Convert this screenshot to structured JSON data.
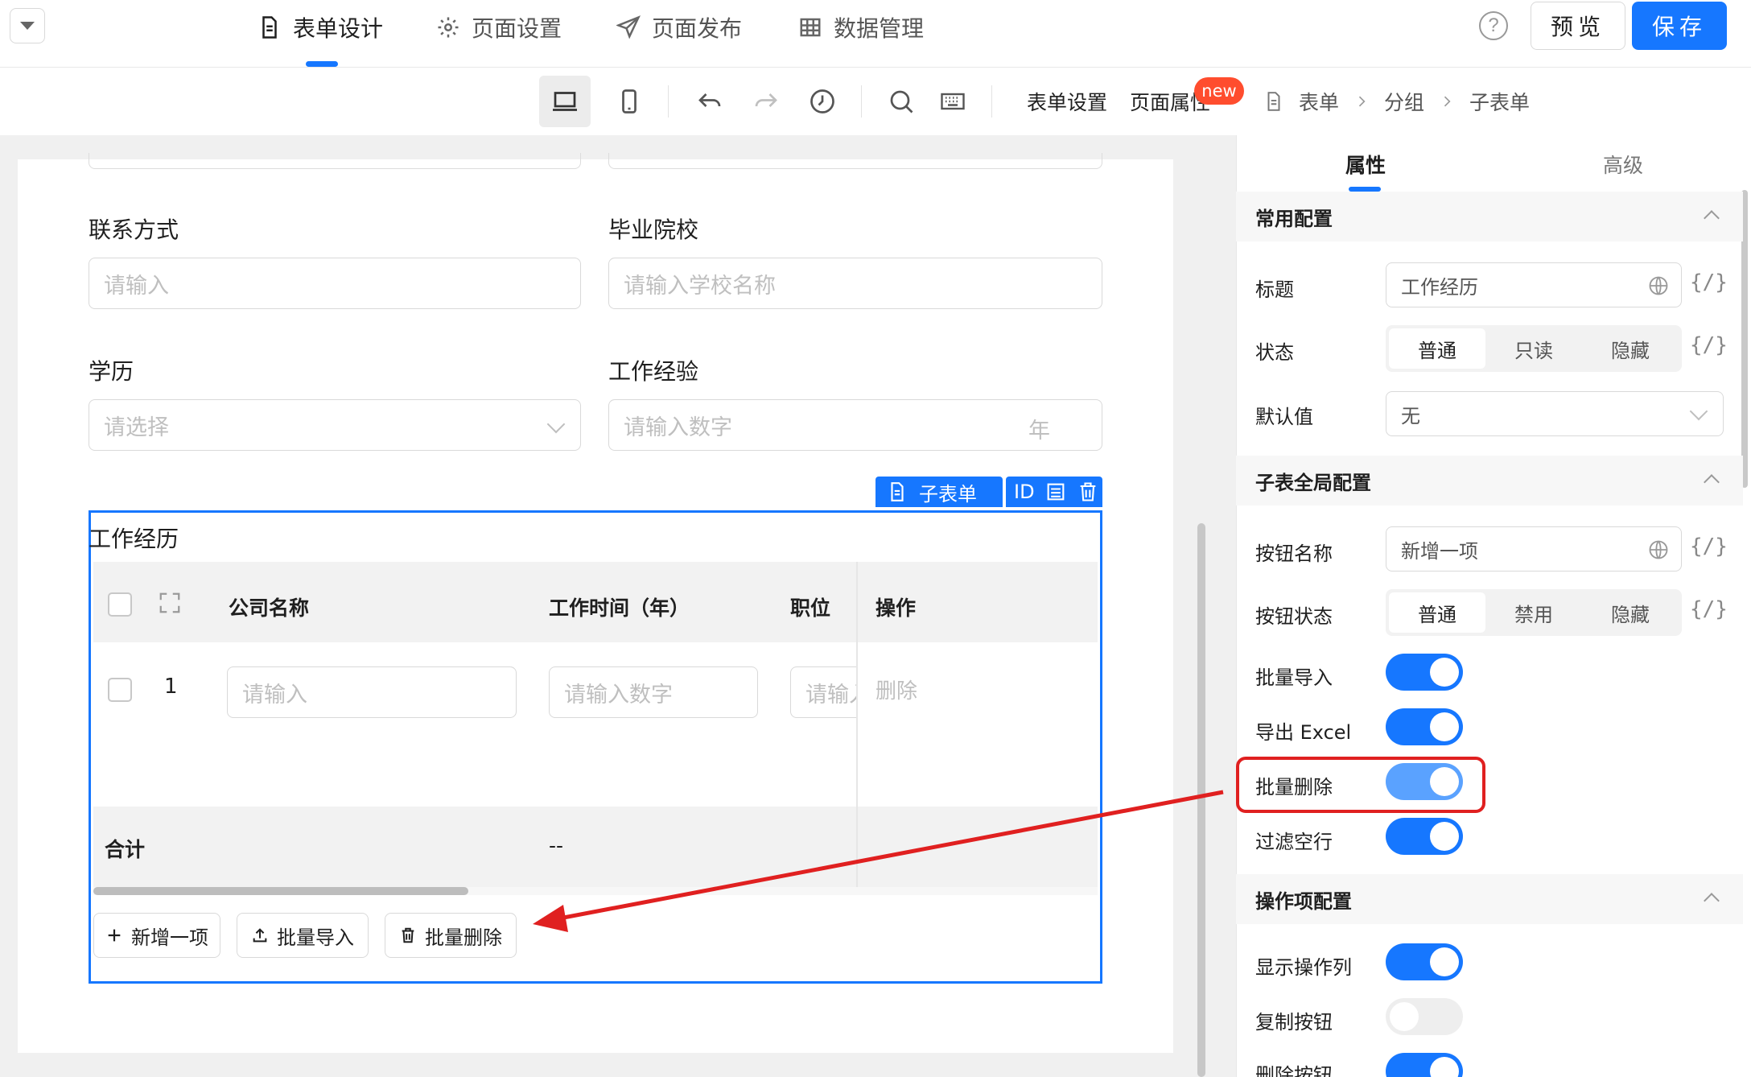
{
  "nav": {
    "tabs": [
      {
        "label": "表单设计",
        "icon": "document-icon",
        "active": true
      },
      {
        "label": "页面设置",
        "icon": "gear-icon",
        "active": false
      },
      {
        "label": "页面发布",
        "icon": "send-icon",
        "active": false
      },
      {
        "label": "数据管理",
        "icon": "table-icon",
        "active": false
      }
    ],
    "help_glyph": "?",
    "preview_label": "预览",
    "save_label": "保存"
  },
  "toolbar": {
    "form_settings_label": "表单设置",
    "page_props_label": "页面属性",
    "new_badge": "new"
  },
  "breadcrumb": [
    "表单",
    "分组",
    "子表单"
  ],
  "form": {
    "fields": [
      {
        "label": "联系方式",
        "placeholder": "请输入"
      },
      {
        "label": "毕业院校",
        "placeholder": "请输入学校名称"
      },
      {
        "label": "学历",
        "placeholder": "请选择"
      },
      {
        "label": "工作经验",
        "placeholder": "请输入数字",
        "suffix": "年"
      }
    ],
    "subform": {
      "tag_label": "子表单",
      "id_label": "ID",
      "title": "工作经历",
      "columns": [
        "公司名称",
        "工作时间（年）",
        "职位",
        "操作"
      ],
      "row": {
        "index": "1",
        "cells": [
          "请输入",
          "请输入数字",
          "请输入"
        ],
        "action": "删除"
      },
      "sum_label": "合计",
      "sum_value": "--",
      "buttons": [
        "新增一项",
        "批量导入",
        "批量删除"
      ]
    }
  },
  "panel": {
    "tabs": [
      "属性",
      "高级"
    ],
    "sections": [
      {
        "title": "常用配置",
        "rows": [
          {
            "label": "标题",
            "value": "工作经历"
          },
          {
            "label": "状态",
            "options": [
              "普通",
              "只读",
              "隐藏"
            ],
            "selected": "普通"
          },
          {
            "label": "默认值",
            "value": "无"
          }
        ]
      },
      {
        "title": "子表全局配置",
        "rows": [
          {
            "label": "按钮名称",
            "value": "新增一项"
          },
          {
            "label": "按钮状态",
            "options": [
              "普通",
              "禁用",
              "隐藏"
            ],
            "selected": "普通"
          },
          {
            "label": "批量导入",
            "on": true
          },
          {
            "label": "导出 Excel",
            "on": true
          },
          {
            "label": "批量删除",
            "on": true
          },
          {
            "label": "过滤空行",
            "on": true
          }
        ]
      },
      {
        "title": "操作项配置",
        "rows": [
          {
            "label": "显示操作列",
            "on": true
          },
          {
            "label": "复制按钮",
            "on": false
          },
          {
            "label": "删除按钮",
            "on": true
          }
        ]
      }
    ],
    "code_glyph": "{/}"
  },
  "colors": {
    "accent": "#1677ff",
    "highlight": "#e02020",
    "badge": "#ff4d2e"
  }
}
